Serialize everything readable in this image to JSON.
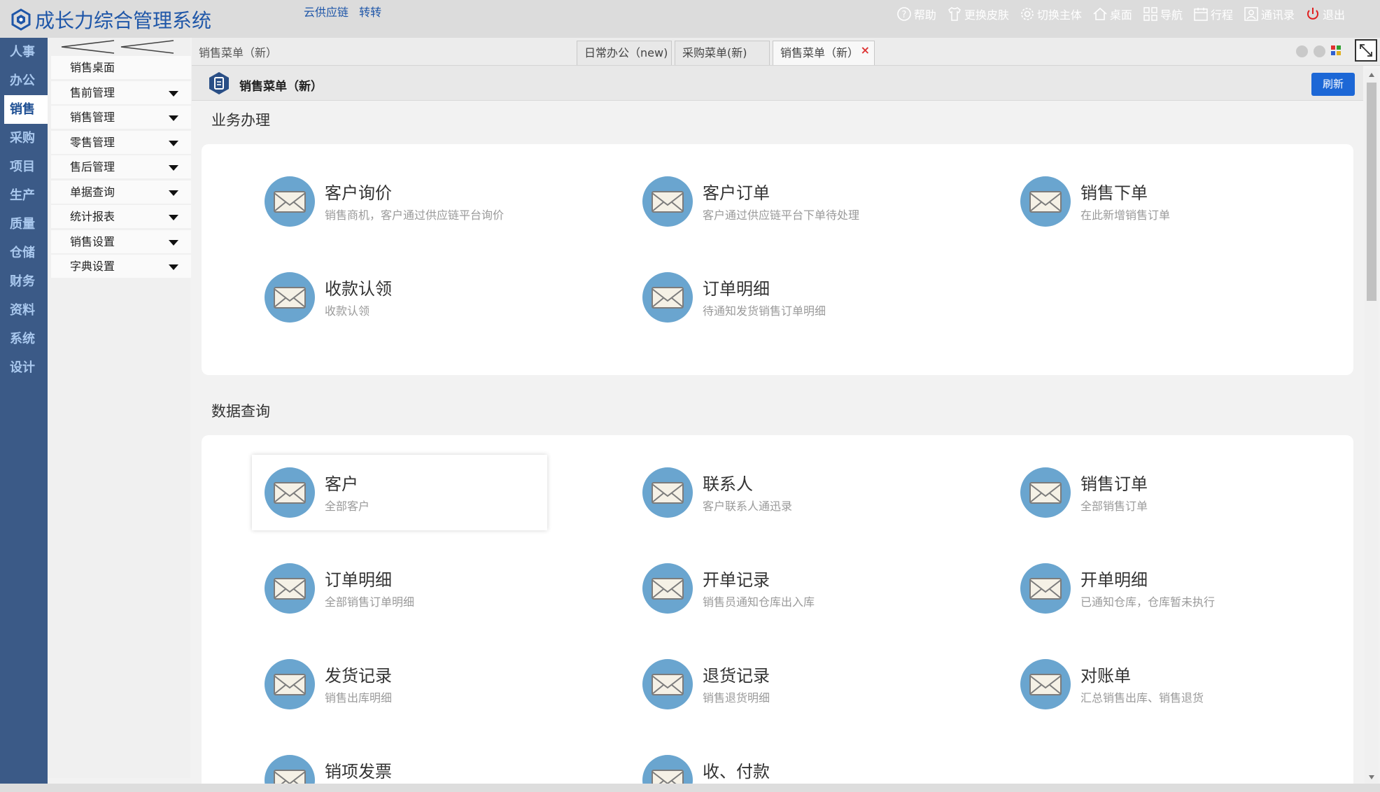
{
  "app": {
    "title": "成长力综合管理系统",
    "links": [
      "云供应链",
      "转转"
    ]
  },
  "toolbar": [
    {
      "label": "帮助",
      "icon": "help-icon"
    },
    {
      "label": "更换皮肤",
      "icon": "shirt-icon"
    },
    {
      "label": "切换主体",
      "icon": "gear-icon"
    },
    {
      "label": "桌面",
      "icon": "home-icon"
    },
    {
      "label": "导航",
      "icon": "grid-icon"
    },
    {
      "label": "行程",
      "icon": "calendar-icon"
    },
    {
      "label": "通讯录",
      "icon": "contact-icon"
    },
    {
      "label": "退出",
      "icon": "power-icon"
    }
  ],
  "leftnav": [
    "人事",
    "办公",
    "销售",
    "采购",
    "项目",
    "生产",
    "质量",
    "仓储",
    "财务",
    "资料",
    "系统",
    "设计"
  ],
  "leftnav_active": 2,
  "submenu": [
    {
      "label": "销售桌面",
      "expandable": false
    },
    {
      "label": "售前管理",
      "expandable": true
    },
    {
      "label": "销售管理",
      "expandable": true
    },
    {
      "label": "零售管理",
      "expandable": true
    },
    {
      "label": "售后管理",
      "expandable": true
    },
    {
      "label": "单据查询",
      "expandable": true
    },
    {
      "label": "统计报表",
      "expandable": true
    },
    {
      "label": "销售设置",
      "expandable": true
    },
    {
      "label": "字典设置",
      "expandable": true
    }
  ],
  "breadcrumb": "销售菜单（新）",
  "tabs": [
    {
      "label": "日常办公（new)"
    },
    {
      "label": "采购菜单(新)"
    },
    {
      "label": "销售菜单（新）",
      "close": "×"
    }
  ],
  "page": {
    "title": "销售菜单（新）",
    "refresh": "刷新"
  },
  "sections": [
    {
      "title": "业务办理",
      "items": [
        {
          "title": "客户询价",
          "desc": "销售商机，客户通过供应链平台询价"
        },
        {
          "title": "客户订单",
          "desc": "客户通过供应链平台下单待处理"
        },
        {
          "title": "销售下单",
          "desc": "在此新增销售订单"
        },
        {
          "title": "收款认领",
          "desc": "收款认领"
        },
        {
          "title": "订单明细",
          "desc": "待通知发货销售订单明细"
        }
      ]
    },
    {
      "title": "数据查询",
      "items": [
        {
          "title": "客户",
          "desc": "全部客户"
        },
        {
          "title": "联系人",
          "desc": "客户联系人通迅录"
        },
        {
          "title": "销售订单",
          "desc": "全部销售订单"
        },
        {
          "title": "订单明细",
          "desc": "全部销售订单明细"
        },
        {
          "title": "开单记录",
          "desc": "销售员通知仓库出入库"
        },
        {
          "title": "开单明细",
          "desc": "已通知仓库，仓库暂未执行"
        },
        {
          "title": "发货记录",
          "desc": "销售出库明细"
        },
        {
          "title": "退货记录",
          "desc": "销售退货明细"
        },
        {
          "title": "对账单",
          "desc": "汇总销售出库、销售退货"
        },
        {
          "title": "销项发票",
          "desc": ""
        },
        {
          "title": "收、付款",
          "desc": ""
        }
      ]
    }
  ],
  "colors": {
    "header_bg": "#dcdcdc",
    "brand": "#1e56a8",
    "leftnav_bg": "#3b5a87",
    "accent_button": "#1c67d6",
    "icon_circle": "#6aa5cf"
  }
}
